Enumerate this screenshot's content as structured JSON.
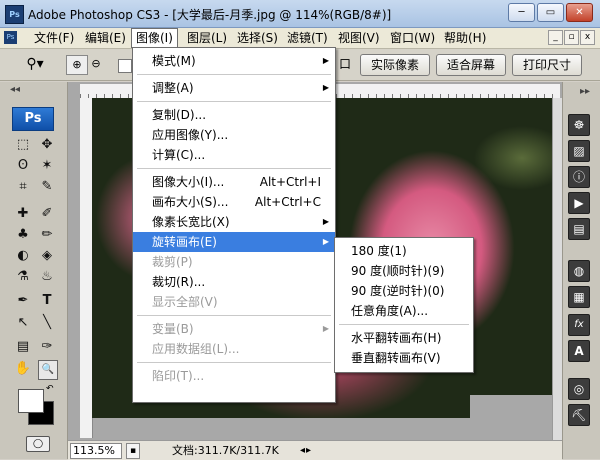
{
  "window": {
    "title": "Adobe Photoshop CS3 - [大学最后-月季.jpg @ 114%(RGB/8#)]",
    "app_icon_text": "Ps",
    "btn_minimize": "─",
    "btn_restore": "▭",
    "btn_close": "✕"
  },
  "menubar": {
    "items": [
      "文件(F)",
      "编辑(E)",
      "图像(I)",
      "图层(L)",
      "选择(S)",
      "滤镜(T)",
      "视图(V)",
      "窗口(W)",
      "帮助(H)"
    ],
    "mdi_minimize": "_",
    "mdi_restore": "▫",
    "mdi_close": "x"
  },
  "options_bar": {
    "tool_icon": "magnifier-icon",
    "partial_label": "口",
    "buttons": [
      "实际像素",
      "适合屏幕",
      "打印尺寸"
    ]
  },
  "toolpanel": {
    "collapse_arrows": "◂◂",
    "logo": "Ps",
    "tools": [
      "⬚",
      "✥",
      "ʘ",
      "✶",
      "⌗",
      "✎",
      "✚",
      "✐",
      "♣",
      "✏",
      "◐",
      "◈",
      "⚗",
      "♨",
      "✒",
      "T",
      "↖",
      "╲",
      "▤",
      "✑",
      "✋",
      "🔍"
    ]
  },
  "image_menu": {
    "items": [
      {
        "label": "模式(M)",
        "shortcut": "",
        "submenu": true,
        "disabled": false
      },
      {
        "sep": true
      },
      {
        "label": "调整(A)",
        "shortcut": "",
        "submenu": true,
        "disabled": false
      },
      {
        "sep": true
      },
      {
        "label": "复制(D)...",
        "shortcut": "",
        "submenu": false,
        "disabled": false
      },
      {
        "label": "应用图像(Y)...",
        "shortcut": "",
        "submenu": false,
        "disabled": false
      },
      {
        "label": "计算(C)...",
        "shortcut": "",
        "submenu": false,
        "disabled": false
      },
      {
        "sep": true
      },
      {
        "label": "图像大小(I)...",
        "shortcut": "Alt+Ctrl+I",
        "submenu": false,
        "disabled": false
      },
      {
        "label": "画布大小(S)...",
        "shortcut": "Alt+Ctrl+C",
        "submenu": false,
        "disabled": false
      },
      {
        "label": "像素长宽比(X)",
        "shortcut": "",
        "submenu": true,
        "disabled": false
      },
      {
        "label": "旋转画布(E)",
        "shortcut": "",
        "submenu": true,
        "disabled": false,
        "highlighted": true
      },
      {
        "label": "裁剪(P)",
        "shortcut": "",
        "submenu": false,
        "disabled": true
      },
      {
        "label": "裁切(R)...",
        "shortcut": "",
        "submenu": false,
        "disabled": false
      },
      {
        "label": "显示全部(V)",
        "shortcut": "",
        "submenu": false,
        "disabled": true
      },
      {
        "sep": true
      },
      {
        "label": "变量(B)",
        "shortcut": "",
        "submenu": true,
        "disabled": true
      },
      {
        "label": "应用数据组(L)...",
        "shortcut": "",
        "submenu": false,
        "disabled": true
      },
      {
        "sep": true
      },
      {
        "label": "陷印(T)...",
        "shortcut": "",
        "submenu": false,
        "disabled": true
      }
    ]
  },
  "rotate_submenu": {
    "items": [
      {
        "label": "180 度(1)"
      },
      {
        "label": "90 度(顺时针)(9)"
      },
      {
        "label": "90 度(逆时针)(0)"
      },
      {
        "label": "任意角度(A)..."
      },
      {
        "sep": true
      },
      {
        "label": "水平翻转画布(H)"
      },
      {
        "label": "垂直翻转画布(V)"
      }
    ]
  },
  "statusbar": {
    "zoom": "113.5%",
    "doc_info": "文档:311.7K/311.7K",
    "arrow_left": "◂",
    "arrow_right": "▸"
  },
  "right_panel": {
    "icons": [
      "☸",
      "▨",
      "ⓘ",
      "▶",
      "▤",
      "◍",
      "▦",
      "fx",
      "A",
      "◎",
      "⛏"
    ]
  }
}
